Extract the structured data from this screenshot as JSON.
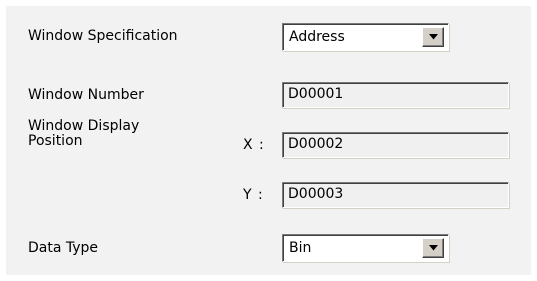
{
  "window_spec": {
    "label": "Window Specification",
    "selected": "Address",
    "dropdown_icon": "chevron-down-icon"
  },
  "window_number": {
    "label": "Window Number",
    "value": "D00001"
  },
  "display_position": {
    "label_line1": "Window Display",
    "label_line2": "Position",
    "x_label": "X :",
    "x_value": "D00002",
    "y_label": "Y :",
    "y_value": "D00003"
  },
  "data_type": {
    "label": "Data Type",
    "selected": "Bin",
    "dropdown_icon": "chevron-down-icon"
  }
}
